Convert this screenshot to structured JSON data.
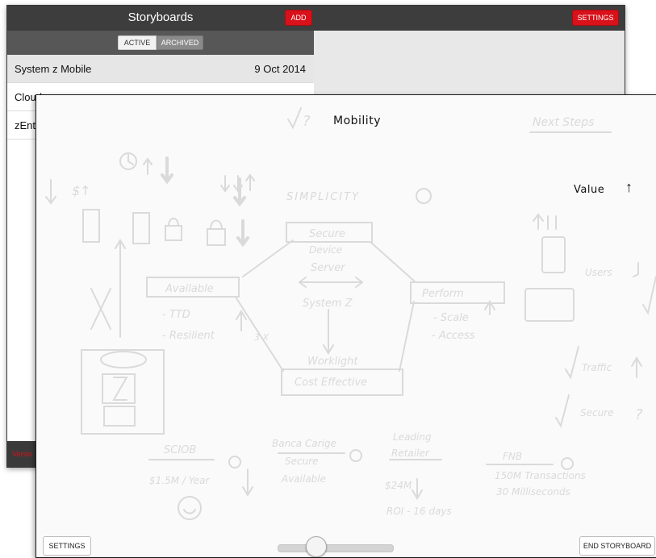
{
  "list_window": {
    "title": "Storyboards",
    "add_label": "ADD",
    "settings_label": "SETTINGS",
    "tabs": [
      {
        "label": "ACTIVE",
        "selected": true
      },
      {
        "label": "ARCHIVED",
        "selected": false
      }
    ],
    "items": [
      {
        "name": "System z Mobile",
        "date": "9 Oct 2014"
      },
      {
        "name": "Cloud",
        "date": ""
      },
      {
        "name": "zEnte",
        "date": ""
      }
    ],
    "footer_version": "Versio"
  },
  "storyboard": {
    "heading": "Mobility",
    "value_label": "Value",
    "value_arrow": "↑",
    "settings_label": "SETTINGS",
    "end_label": "END STORYBOARD",
    "slider_value": 0.3,
    "faded_sketch": {
      "next_steps": "Next Steps",
      "simplicity": "SIMPLICITY",
      "secure": "Secure",
      "device": "Device",
      "server": "Server",
      "available": "Available",
      "ttd": "- TTD",
      "resilient": "- Resilient",
      "three_x": "3 X",
      "system_z": "System Z",
      "perform": "Perform",
      "scale": "- Scale",
      "access": "- Access",
      "worklight": "Worklight",
      "cost_effective": "Cost Effective",
      "users": "Users",
      "traffic": "Traffic",
      "secure_right": "Secure",
      "sciob": "SCIOB",
      "per_year": "$1.5M / Year",
      "banca": "Banca Carige",
      "banca_secure": "Secure",
      "banca_available": "Available",
      "leading": "Leading",
      "retailer": "Retailer",
      "retailer_amount": "$24M",
      "roi": "ROI - 16 days",
      "fnb": "FNB",
      "transactions": "150M Transactions",
      "milliseconds": "30 Milliseconds"
    }
  },
  "colors": {
    "accent_red": "#d8111a",
    "header_dark": "#3d3d3d",
    "sketch_faded": "#d9d9d9"
  }
}
